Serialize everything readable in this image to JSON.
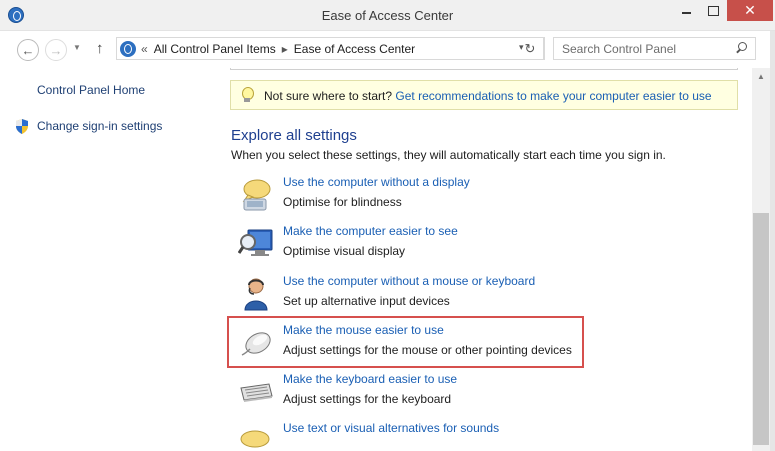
{
  "window": {
    "title": "Ease of Access Center",
    "colors": {
      "close_button": "#c7504a",
      "link": "#1a5fb4",
      "heading": "#1e3f8f",
      "tip_background": "#ffffe1",
      "highlight": "#d6504e"
    }
  },
  "nav": {
    "back_label": "←",
    "forward_label": "→",
    "up_label": "↑",
    "recent_label": "▼",
    "refresh_label": "↻"
  },
  "address": {
    "overflow": "«",
    "crumbs": [
      "All Control Panel Items",
      "Ease of Access Center"
    ],
    "separator": "▸",
    "dropdown": "▾"
  },
  "search": {
    "placeholder": "Search Control Panel"
  },
  "sidebar": {
    "home": "Control Panel Home",
    "signin": "Change sign-in settings"
  },
  "tip": {
    "text": "Not sure where to start?",
    "link": "Get recommendations to make your computer easier to use"
  },
  "explore": {
    "title": "Explore all settings",
    "subtitle": "When you select these settings, they will automatically start each time you sign in.",
    "options": [
      {
        "link": "Use the computer without a display",
        "desc": "Optimise for blindness",
        "icon": "speech-bubble-icon"
      },
      {
        "link": "Make the computer easier to see",
        "desc": "Optimise visual display",
        "icon": "magnifier-monitor-icon"
      },
      {
        "link": "Use the computer without a mouse or keyboard",
        "desc": "Set up alternative input devices",
        "icon": "person-headset-icon"
      },
      {
        "link": "Make the mouse easier to use",
        "desc": "Adjust settings for the mouse or other pointing devices",
        "icon": "mouse-icon"
      },
      {
        "link": "Make the keyboard easier to use",
        "desc": "Adjust settings for the keyboard",
        "icon": "keyboard-icon"
      },
      {
        "link": "Use text or visual alternatives for sounds",
        "desc": "",
        "icon": "sound-bubble-icon"
      }
    ]
  },
  "scrollbar": {
    "up_arrow": "▲"
  }
}
